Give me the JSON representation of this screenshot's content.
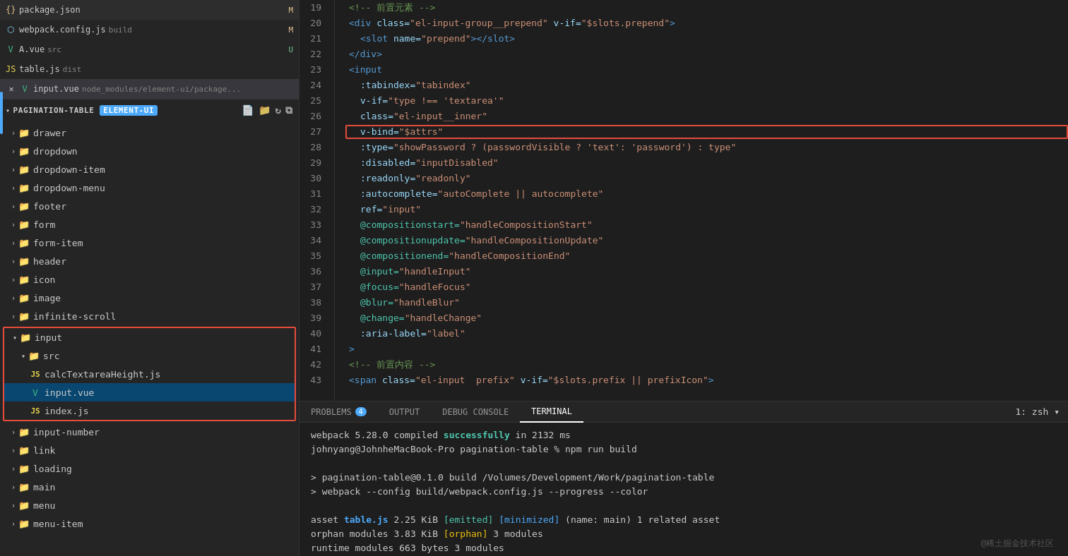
{
  "sidebar": {
    "section_title": "PAGINATION-TABLE",
    "files": [
      {
        "name": "package.json",
        "icon": "{}",
        "icon_class": "icon-json",
        "badge": "M",
        "badge_class": "badge"
      },
      {
        "name": "webpack.config.js",
        "suffix": "build",
        "icon": "W",
        "icon_class": "icon-webpack",
        "badge": "M",
        "badge_class": "badge"
      },
      {
        "name": "A.vue",
        "suffix": "src",
        "icon": "V",
        "icon_class": "icon-vue",
        "badge": "U",
        "badge_class": "badge-u"
      },
      {
        "name": "table.js",
        "suffix": "dist",
        "icon": "JS",
        "icon_class": "icon-js"
      },
      {
        "name": "input.vue",
        "suffix": "node_modules/element-ui/package...",
        "icon": "V",
        "icon_class": "icon-vue",
        "is_active_tab": true
      }
    ],
    "tree_items_before": [
      {
        "label": "drawer",
        "indent": 16,
        "chevron": "›"
      },
      {
        "label": "dropdown",
        "indent": 16,
        "chevron": "›"
      },
      {
        "label": "dropdown-item",
        "indent": 16,
        "chevron": "›"
      },
      {
        "label": "dropdown-menu",
        "indent": 16,
        "chevron": "›"
      },
      {
        "label": "footer",
        "indent": 16,
        "chevron": "›"
      },
      {
        "label": "form",
        "indent": 16,
        "chevron": "›"
      },
      {
        "label": "form-item",
        "indent": 16,
        "chevron": "›"
      },
      {
        "label": "header",
        "indent": 16,
        "chevron": "›"
      },
      {
        "label": "icon",
        "indent": 16,
        "chevron": "›"
      },
      {
        "label": "image",
        "indent": 16,
        "chevron": "›"
      },
      {
        "label": "infinite-scroll",
        "indent": 16,
        "chevron": "›"
      }
    ],
    "input_group": {
      "input_folder": "input",
      "src_folder": "src",
      "files": [
        {
          "name": "calcTextareaHeight.js",
          "icon": "JS",
          "icon_class": "icon-js"
        },
        {
          "name": "input.vue",
          "icon": "V",
          "icon_class": "icon-vue",
          "selected": true
        },
        {
          "name": "index.js",
          "icon": "JS",
          "icon_class": "icon-js"
        }
      ]
    },
    "tree_items_after": [
      {
        "label": "input-number",
        "indent": 16,
        "chevron": "›"
      },
      {
        "label": "link",
        "indent": 16,
        "chevron": "›"
      },
      {
        "label": "loading",
        "indent": 16,
        "chevron": "›"
      },
      {
        "label": "main",
        "indent": 16,
        "chevron": "›"
      },
      {
        "label": "menu",
        "indent": 16,
        "chevron": "›"
      },
      {
        "label": "menu-item",
        "indent": 16,
        "chevron": "›"
      }
    ],
    "element_ui_badge": "element-ui"
  },
  "editor": {
    "lines": [
      {
        "num": 19,
        "content": [
          {
            "text": "<!-- 前置元素 -->",
            "cls": "comment"
          }
        ]
      },
      {
        "num": 20,
        "content": [
          {
            "text": "<div ",
            "cls": "tag"
          },
          {
            "text": "class=",
            "cls": "attr-name"
          },
          {
            "text": "\"el-input-group__prepend\"",
            "cls": "attr-value"
          },
          {
            "text": " v-if=",
            "cls": "attr-name"
          },
          {
            "text": "\"$slots.prepend\"",
            "cls": "attr-value"
          },
          {
            "text": ">",
            "cls": "tag"
          }
        ]
      },
      {
        "num": 21,
        "content": [
          {
            "text": "  <slot ",
            "cls": "tag"
          },
          {
            "text": "name=",
            "cls": "attr-name"
          },
          {
            "text": "\"prepend\"",
            "cls": "attr-value"
          },
          {
            "text": "></slot>",
            "cls": "tag"
          }
        ]
      },
      {
        "num": 22,
        "content": [
          {
            "text": "</div>",
            "cls": "tag"
          }
        ]
      },
      {
        "num": 23,
        "content": [
          {
            "text": "<input",
            "cls": "tag"
          }
        ]
      },
      {
        "num": 24,
        "content": [
          {
            "text": "  :tabindex=",
            "cls": "attr-name"
          },
          {
            "text": "\"tabindex\"",
            "cls": "attr-value"
          }
        ]
      },
      {
        "num": 25,
        "content": [
          {
            "text": "  v-if=",
            "cls": "attr-name"
          },
          {
            "text": "\"type !== 'textarea'\"",
            "cls": "attr-value"
          }
        ]
      },
      {
        "num": 26,
        "content": [
          {
            "text": "  class=",
            "cls": "attr-name"
          },
          {
            "text": "\"el-input__inner\"",
            "cls": "attr-value"
          }
        ]
      },
      {
        "num": 27,
        "content": [
          {
            "text": "  v-bind=",
            "cls": "attr-name"
          },
          {
            "text": "\"$attrs\"",
            "cls": "attr-value"
          }
        ],
        "highlight": true
      },
      {
        "num": 28,
        "content": [
          {
            "text": "  :type=",
            "cls": "attr-name"
          },
          {
            "text": "\"showPassword ? (passwordVisible ? 'text': 'password') : type\"",
            "cls": "attr-value"
          }
        ]
      },
      {
        "num": 29,
        "content": [
          {
            "text": "  :disabled=",
            "cls": "attr-name"
          },
          {
            "text": "\"inputDisabled\"",
            "cls": "attr-value"
          }
        ]
      },
      {
        "num": 30,
        "content": [
          {
            "text": "  :readonly=",
            "cls": "attr-name"
          },
          {
            "text": "\"readonly\"",
            "cls": "attr-value"
          }
        ]
      },
      {
        "num": 31,
        "content": [
          {
            "text": "  :autocomplete=",
            "cls": "attr-name"
          },
          {
            "text": "\"autoComplete || autocomplete\"",
            "cls": "attr-value"
          }
        ]
      },
      {
        "num": 32,
        "content": [
          {
            "text": "  ref=",
            "cls": "attr-name"
          },
          {
            "text": "\"input\"",
            "cls": "attr-value"
          }
        ]
      },
      {
        "num": 33,
        "content": [
          {
            "text": "  @compositionstart=",
            "cls": "event"
          },
          {
            "text": "\"handleCompositionStart\"",
            "cls": "attr-value"
          }
        ]
      },
      {
        "num": 34,
        "content": [
          {
            "text": "  @compositionupdate=",
            "cls": "event"
          },
          {
            "text": "\"handleCompositionUpdate\"",
            "cls": "attr-value"
          }
        ]
      },
      {
        "num": 35,
        "content": [
          {
            "text": "  @compositionend=",
            "cls": "event"
          },
          {
            "text": "\"handleCompositionEnd\"",
            "cls": "attr-value"
          }
        ]
      },
      {
        "num": 36,
        "content": [
          {
            "text": "  @input=",
            "cls": "event"
          },
          {
            "text": "\"handleInput\"",
            "cls": "attr-value"
          }
        ]
      },
      {
        "num": 37,
        "content": [
          {
            "text": "  @focus=",
            "cls": "event"
          },
          {
            "text": "\"handleFocus\"",
            "cls": "attr-value"
          }
        ]
      },
      {
        "num": 38,
        "content": [
          {
            "text": "  @blur=",
            "cls": "event"
          },
          {
            "text": "\"handleBlur\"",
            "cls": "attr-value"
          }
        ]
      },
      {
        "num": 39,
        "content": [
          {
            "text": "  @change=",
            "cls": "event"
          },
          {
            "text": "\"handleChange\"",
            "cls": "attr-value"
          }
        ]
      },
      {
        "num": 40,
        "content": [
          {
            "text": "  :aria-label=",
            "cls": "attr-name"
          },
          {
            "text": "\"label\"",
            "cls": "attr-value"
          }
        ]
      },
      {
        "num": 41,
        "content": [
          {
            "text": ">",
            "cls": "tag"
          }
        ]
      },
      {
        "num": 42,
        "content": [
          {
            "text": "<!-- 前置内容 -->",
            "cls": "comment"
          }
        ]
      },
      {
        "num": 43,
        "content": [
          {
            "text": "<span ",
            "cls": "tag"
          },
          {
            "text": "class=",
            "cls": "attr-name"
          },
          {
            "text": "\"el-input  prefix\"",
            "cls": "attr-value"
          },
          {
            "text": " v-if=",
            "cls": "attr-name"
          },
          {
            "text": "\"$slots.prefix || prefixIcon\">",
            "cls": "attr-value"
          }
        ]
      }
    ]
  },
  "terminal": {
    "tabs": [
      {
        "label": "PROBLEMS",
        "badge": "4"
      },
      {
        "label": "OUTPUT"
      },
      {
        "label": "DEBUG CONSOLE"
      },
      {
        "label": "TERMINAL",
        "active": true
      }
    ],
    "terminal_selector": "1: zsh",
    "output": [
      "webpack 5.28.0 compiled successfully in 2132 ms",
      "johnyang@JohnheMacBook-Pro pagination-table % npm run build",
      "",
      "> pagination-table@0.1.0 build /Volumes/Development/Work/pagination-table",
      "> webpack --config build/webpack.config.js --progress --color",
      "",
      "asset table.js 2.25 KiB [emitted] [minimized] (name: main) 1 related asset",
      "orphan modules 3.83 KiB [orphan] 3 modules",
      "runtime modules 663 bytes 3 modules"
    ],
    "watermark": "@稀土掘金技术社区"
  }
}
